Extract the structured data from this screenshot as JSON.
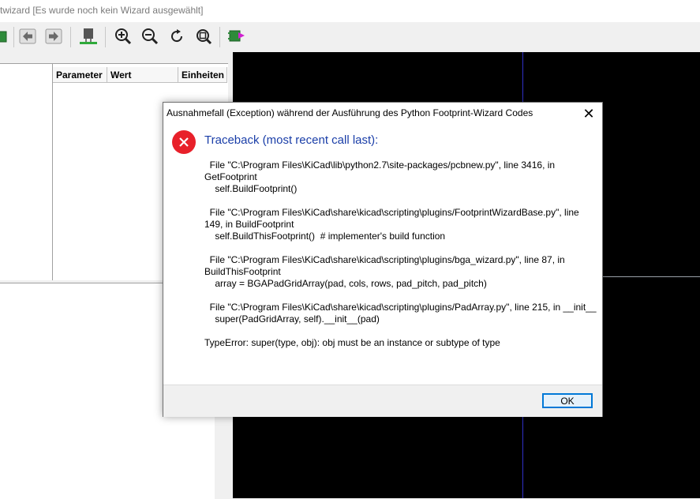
{
  "window": {
    "title": "twizard [Es wurde noch kein Wizard ausgewählt]"
  },
  "toolbar": {
    "icons": [
      "app-icon",
      "previous-icon",
      "next-icon",
      "footprint-editor-icon",
      "zoom-in-icon",
      "zoom-out-icon",
      "redraw-icon",
      "zoom-fit-icon",
      "export-footprint-icon"
    ]
  },
  "parameters": {
    "columns": [
      "Parameter",
      "Wert",
      "Einheiten"
    ]
  },
  "dialog": {
    "title": "Ausnahmefall (Exception) während der Ausführung des Python Footprint-Wizard Codes",
    "close_glyph": "✕",
    "heading": "Traceback (most recent call last):",
    "lines": [
      "  File \"C:\\Program Files\\KiCad\\lib\\python2.7\\site-packages/pcbnew.py\", line 3416, in",
      "GetFootprint",
      "    self.BuildFootprint()",
      "",
      "  File \"C:\\Program Files\\KiCad\\share\\kicad\\scripting\\plugins/FootprintWizardBase.py\", line",
      "149, in BuildFootprint",
      "    self.BuildThisFootprint()  # implementer's build function",
      "",
      "  File \"C:\\Program Files\\KiCad\\share\\kicad\\scripting\\plugins/bga_wizard.py\", line 87, in",
      "BuildThisFootprint",
      "    array = BGAPadGridArray(pad, cols, rows, pad_pitch, pad_pitch)",
      "",
      "  File \"C:\\Program Files\\KiCad\\share\\kicad\\scripting\\plugins/PadArray.py\", line 215, in __init__",
      "    super(PadGridArray, self).__init__(pad)",
      "",
      "TypeError: super(type, obj): obj must be an instance or subtype of type"
    ],
    "ok_label": "OK",
    "icon": "error-icon"
  },
  "colors": {
    "canvas": "#000000",
    "error": "#e8202a",
    "heading": "#1a3ea8",
    "accent": "#0078d7"
  }
}
